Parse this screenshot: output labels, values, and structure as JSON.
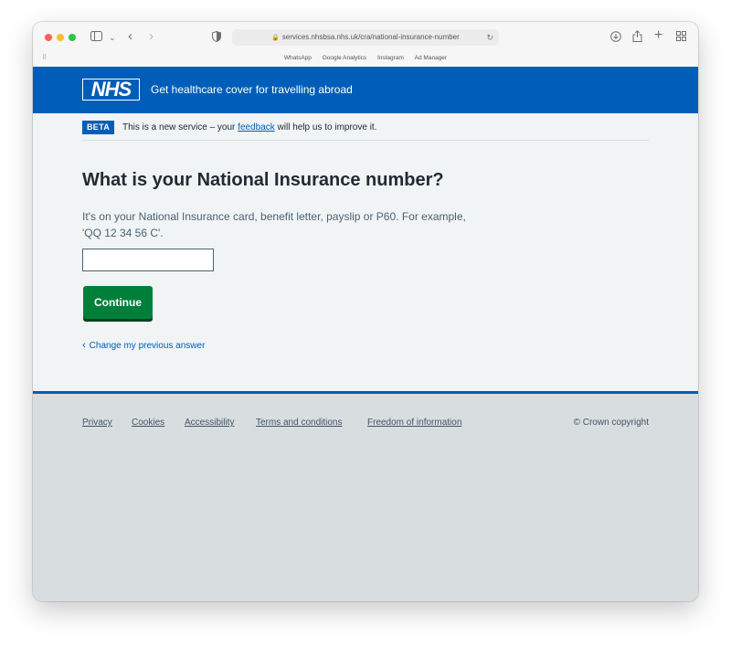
{
  "browser": {
    "url": "services.nhsbsa.nhs.uk/cra/national-insurance-number",
    "bookmarks": [
      "WhatsApp",
      "Google Analytics",
      "Instagram",
      "Ad Manager"
    ]
  },
  "header": {
    "logo_text": "NHS",
    "service_name": "Get healthcare cover for travelling abroad",
    "brand_color": "#005eb8"
  },
  "beta": {
    "tag": "BETA",
    "text_before": "This is a new service – your ",
    "link": "feedback",
    "text_after": " will help us to improve it."
  },
  "main": {
    "heading": "What is your National Insurance number?",
    "hint_line1": "It's on your National Insurance card, benefit letter, payslip or P60. For example,",
    "hint_line2": "'QQ 12 34 56 C'.",
    "input_value": "",
    "continue_label": "Continue",
    "back_link": "Change my previous answer"
  },
  "footer": {
    "links": [
      "Privacy",
      "Cookies",
      "Accessibility",
      "Terms and conditions",
      "Freedom of information"
    ],
    "copyright": "© Crown copyright"
  },
  "icons": {
    "back": "chevron-left-icon",
    "forward": "chevron-right-icon",
    "sidebar": "sidebar-icon",
    "shield": "shield-icon",
    "lock": "lock-icon",
    "reload": "reload-icon",
    "download": "download-icon",
    "share": "share-icon",
    "new_tab": "plus-icon",
    "tabs": "tab-overview-icon"
  }
}
